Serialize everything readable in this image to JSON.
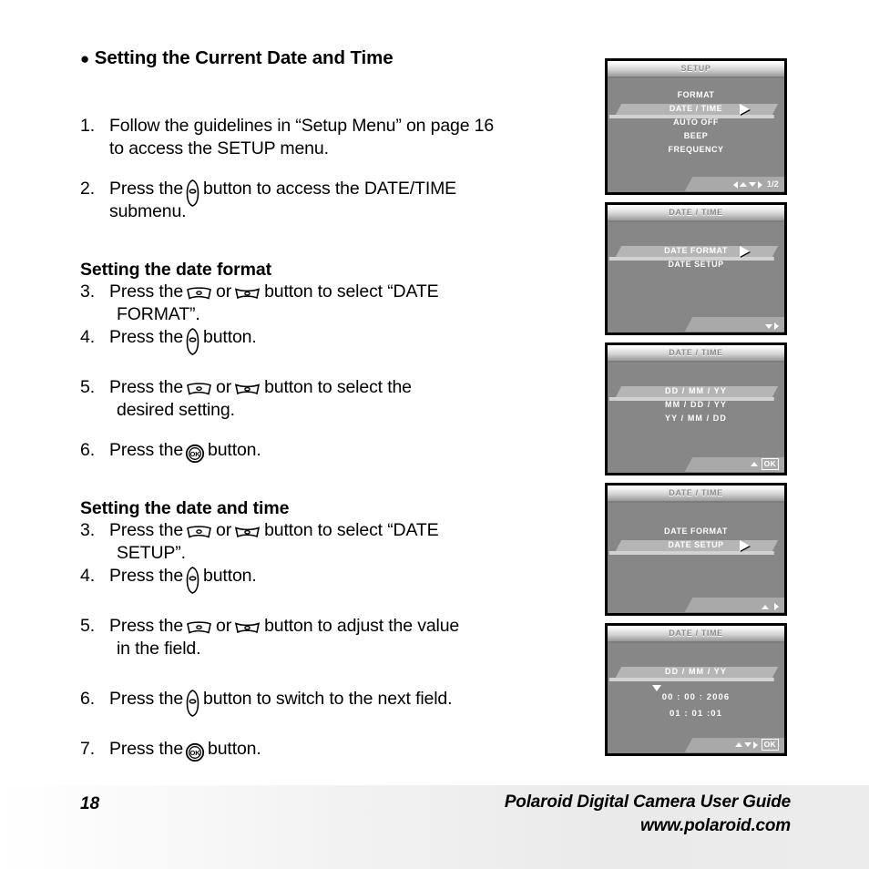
{
  "document": {
    "section_bullet": "Setting the Current Date and Time",
    "steps_intro": [
      {
        "num": "1.",
        "lines": [
          "Follow the guidelines in “Setup Menu” on page 16",
          "to access the SETUP menu."
        ]
      },
      {
        "num": "2.",
        "pre": "Press the",
        "icon": "vertical-rocker-button",
        "post": "button to access the DATE/TIME",
        "line2": "submenu."
      }
    ],
    "section_date_format": {
      "heading": "Setting the date format",
      "steps": [
        {
          "num": "3.",
          "pre": "Press the",
          "icon_a": "zoom-wide-button",
          "mid": "or",
          "icon_b": "zoom-tele-button",
          "post": "button to select “DATE",
          "line2": "FORMAT”."
        },
        {
          "num": "4.",
          "pre": "Press the",
          "icon": "vertical-rocker-button",
          "post": "button."
        },
        {
          "num": "5.",
          "pre": "Press the",
          "icon_a": "zoom-wide-button",
          "mid": "or",
          "icon_b": "zoom-tele-button",
          "post": "button to select the",
          "line2": "desired setting."
        },
        {
          "num": "6.",
          "pre": "Press the",
          "icon": "ok-button",
          "post": "button."
        }
      ]
    },
    "section_date_time": {
      "heading": "Setting the date and time",
      "steps": [
        {
          "num": "3.",
          "pre": "Press the",
          "icon_a": "zoom-wide-button",
          "mid": "or",
          "icon_b": "zoom-tele-button",
          "post": "button to select “DATE",
          "line2": "SETUP”."
        },
        {
          "num": "4.",
          "pre": "Press the",
          "icon": "vertical-rocker-button",
          "post": "button."
        },
        {
          "num": "5.",
          "pre": "Press the",
          "icon_a": "zoom-wide-button",
          "mid": "or",
          "icon_b": "zoom-tele-button",
          "post": "button to adjust the value",
          "line2": "in the field."
        },
        {
          "num": "6.",
          "pre": "Press the",
          "icon": "vertical-rocker-button",
          "post": "button to switch to the next field."
        },
        {
          "num": "7.",
          "pre": "Press the",
          "icon": "ok-button",
          "post": "button."
        }
      ]
    }
  },
  "lcd_screens": [
    {
      "title": "SETUP",
      "items": [
        "FORMAT",
        "DATE / TIME",
        "AUTO OFF",
        "BEEP",
        "FREQUENCY"
      ],
      "selected": "DATE / TIME",
      "page_indicator": "1/2",
      "footer_keys": [
        "left",
        "up",
        "down",
        "right"
      ],
      "has_ok_badge": false
    },
    {
      "title": "DATE / TIME",
      "items": [
        "DATE FORMAT",
        "DATE SETUP"
      ],
      "selected": "DATE FORMAT",
      "page_indicator": "",
      "footer_keys": [
        "down",
        "right"
      ],
      "has_ok_badge": false
    },
    {
      "title": "DATE / TIME",
      "items": [
        "DD / MM / YY",
        "MM / DD / YY",
        "YY / MM / DD"
      ],
      "selected": "DD / MM / YY",
      "page_indicator": "",
      "footer_keys": [
        "up"
      ],
      "has_ok_badge": true,
      "ok_label": "OK"
    },
    {
      "title": "DATE / TIME",
      "items": [
        "DATE FORMAT",
        "DATE SETUP"
      ],
      "selected": "DATE SETUP",
      "page_indicator": "",
      "footer_keys": [
        "up",
        "right"
      ],
      "has_ok_badge": false
    },
    {
      "title": "DATE / TIME",
      "items": [
        "DD / MM / YY"
      ],
      "selected": "DD / MM / YY",
      "date_line": "00 : 00 : 2006",
      "time_line": "01 : 01 :01",
      "page_indicator": "",
      "footer_keys": [
        "up",
        "down",
        "right"
      ],
      "has_ok_badge": true,
      "ok_label": "OK"
    }
  ],
  "footer": {
    "page_number": "18",
    "guide_title": "Polaroid Digital Camera User Guide",
    "website": "www.polaroid.com"
  },
  "colors": {
    "lcd_background": "#878787",
    "lcd_highlight": "#b5b5b5",
    "lcd_text": "#ffffff",
    "bezel": "#000000",
    "footer_band": "#ececec"
  }
}
